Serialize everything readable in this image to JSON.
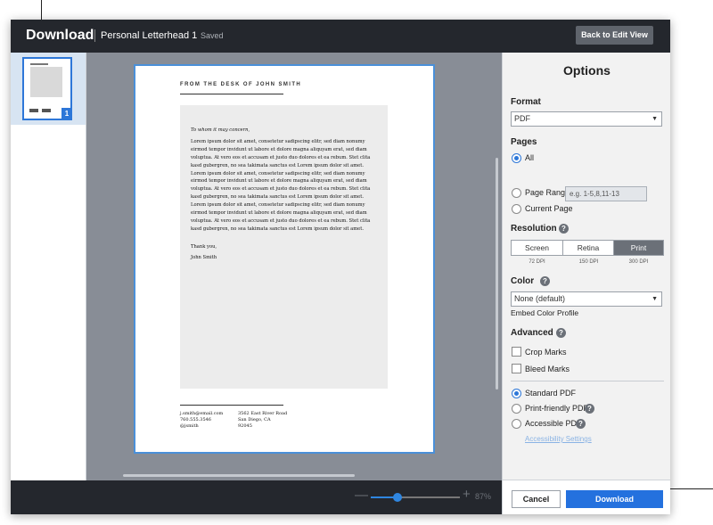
{
  "header": {
    "title": "Download",
    "document_name": "Personal Letterhead 1",
    "save_status": "Saved",
    "back_button": "Back to Edit View"
  },
  "thumbnails": [
    {
      "page_number": "1",
      "selected": true
    }
  ],
  "letter": {
    "header": "FROM THE DESK OF JOHN SMITH",
    "greeting": "To whom it may concern,",
    "body": "Lorem ipsum dolor sit amet, consetetur sadipscing elitr, sed diam nonumy eirmod tempor invidunt ut labore et dolore magna aliquyam erat, sed diam voluptua. At vero eos et accusam et justo duo dolores et ea rebum. Stet clita kasd gubergren, no sea takimata sanctus est Lorem ipsum dolor sit amet. Lorem ipsum dolor sit amet, consetetur sadipscing elitr, sed diam nonumy eirmod tempor invidunt ut labore et dolore magna aliquyam erat, sed diam voluptua. At vero eos et accusam et justo duo dolores et ea rebum. Stet clita kasd gubergren, no sea takimata sanctus est Lorem ipsum dolor sit amet. Lorem ipsum dolor sit amet, consetetur sadipscing elitr, sed diam nonumy eirmod tempor invidunt ut labore et dolore magna aliquyam erat, sed diam voluptua. At vero eos et accusam et justo duo dolores et ea rebum. Stet clita kasd gubergren, no sea takimata sanctus est Lorem ipsum dolor sit amet.",
    "closing": "Thank you,",
    "signature": "John Smith",
    "footer_email": "j.smith@email.com",
    "footer_phone": "760.555.3546",
    "footer_handle": "@jsmith",
    "footer_street": "3562 East River Road",
    "footer_city": "San Diego, CA",
    "footer_zip": "92045"
  },
  "zoom": {
    "minus": "—",
    "plus": "+",
    "level_label": "87%",
    "level_fraction": 0.3
  },
  "options": {
    "title": "Options",
    "format": {
      "label": "Format",
      "value": "PDF"
    },
    "pages": {
      "label": "Pages",
      "all": "All",
      "page_range": "Page Range",
      "page_range_placeholder": "e.g. 1-5,8,11-13",
      "current_page": "Current Page",
      "selected": "All"
    },
    "resolution": {
      "label": "Resolution",
      "screen": "Screen",
      "retina": "Retina",
      "print": "Print",
      "screen_dpi": "72 DPI",
      "retina_dpi": "150 DPI",
      "print_dpi": "300 DPI",
      "selected": "Print"
    },
    "color": {
      "label": "Color",
      "value": "None (default)",
      "embed_profile": "Embed Color Profile"
    },
    "advanced": {
      "label": "Advanced",
      "crop_marks": "Crop Marks",
      "bleed_marks": "Bleed Marks",
      "standard_pdf": "Standard PDF",
      "print_friendly_pdf": "Print-friendly PDF",
      "accessible_pdf": "Accessible PDF",
      "accessibility_settings": "Accessibility Settings",
      "selected_pdf_type": "Standard PDF"
    },
    "cancel_button": "Cancel",
    "download_button": "Download"
  },
  "colors": {
    "accent": "#2471de",
    "topbar": "#24272d",
    "canvas": "#888d96"
  }
}
